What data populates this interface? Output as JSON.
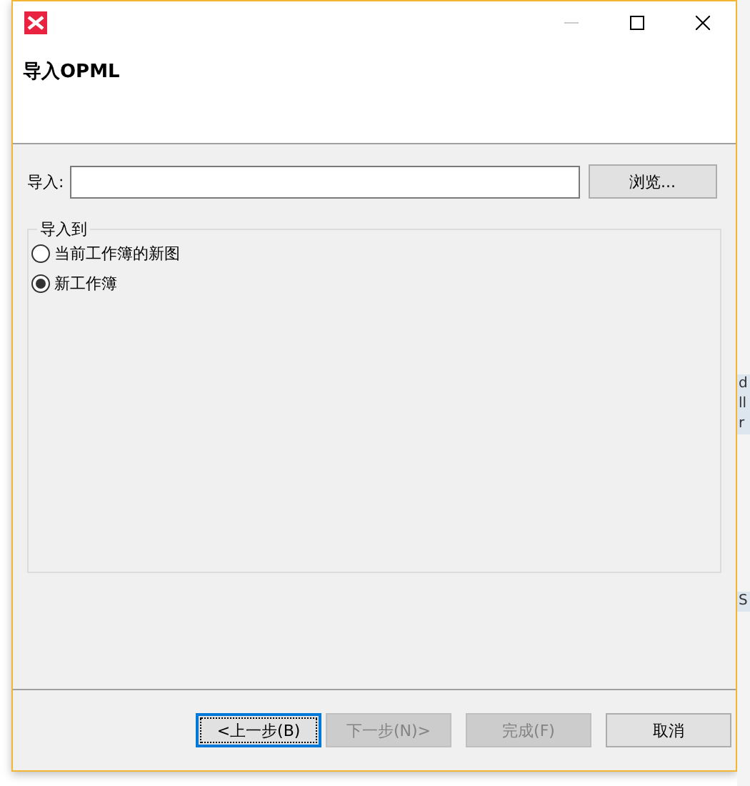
{
  "window": {
    "title": "导入OPML"
  },
  "import_field": {
    "label": "导入:",
    "browse_button": "浏览..."
  },
  "group": {
    "title": "导入到",
    "options": [
      {
        "label": "当前工作簿的新图",
        "selected": false
      },
      {
        "label": "新工作簿",
        "selected": true
      }
    ]
  },
  "buttons": [
    {
      "label": "<上一步(B)",
      "disabled": false,
      "focused": true
    },
    {
      "label": "下一步(N)>",
      "disabled": true,
      "focused": false
    },
    {
      "label": "完成(F)",
      "disabled": true,
      "focused": false
    },
    {
      "label": "取消",
      "disabled": false,
      "focused": false
    }
  ],
  "background_fragments": [
    "d",
    "ll",
    "r",
    "S"
  ]
}
